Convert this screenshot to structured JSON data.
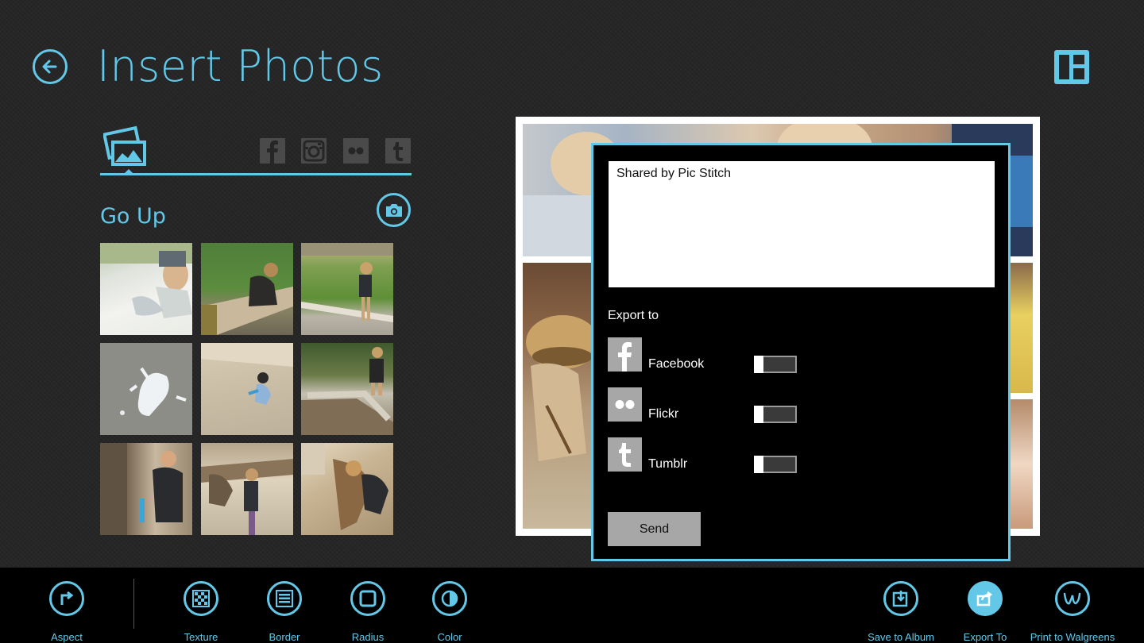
{
  "header": {
    "title": "Insert Photos",
    "back_icon": "back-arrow-icon",
    "layout_icon": "layout-grid-icon"
  },
  "sources": {
    "tabs": [
      {
        "name": "device-photos",
        "icon": "pictures-icon",
        "selected": true
      },
      {
        "name": "facebook",
        "icon": "facebook-icon"
      },
      {
        "name": "instagram",
        "icon": "instagram-icon"
      },
      {
        "name": "flickr",
        "icon": "flickr-icon"
      },
      {
        "name": "tumblr",
        "icon": "tumblr-icon"
      }
    ]
  },
  "folder": {
    "label": "Go Up",
    "camera_icon": "camera-icon"
  },
  "dialog": {
    "message": "Shared by Pic Stitch",
    "export_label": "Export to",
    "services": [
      {
        "name": "Facebook",
        "icon": "facebook-icon",
        "enabled": false
      },
      {
        "name": "Flickr",
        "icon": "flickr-icon",
        "enabled": false
      },
      {
        "name": "Tumblr",
        "icon": "tumblr-icon",
        "enabled": false
      }
    ],
    "send_label": "Send"
  },
  "app_bar": {
    "left": [
      {
        "label": "Aspect",
        "icon": "aspect-icon"
      }
    ],
    "middle": [
      {
        "label": "Texture",
        "icon": "texture-icon"
      },
      {
        "label": "Border",
        "icon": "border-icon"
      },
      {
        "label": "Radius",
        "icon": "radius-icon"
      },
      {
        "label": "Color",
        "icon": "color-icon"
      }
    ],
    "right": [
      {
        "label": "Save to Album",
        "icon": "save-to-album-icon"
      },
      {
        "label": "Export To",
        "icon": "export-icon",
        "active": true
      },
      {
        "label": "Print to Walgreens",
        "icon": "walgreens-icon"
      }
    ]
  },
  "colors": {
    "accent": "#63c8e8",
    "background": "#262626",
    "app_bar": "#000000",
    "dialog": "#000000"
  }
}
